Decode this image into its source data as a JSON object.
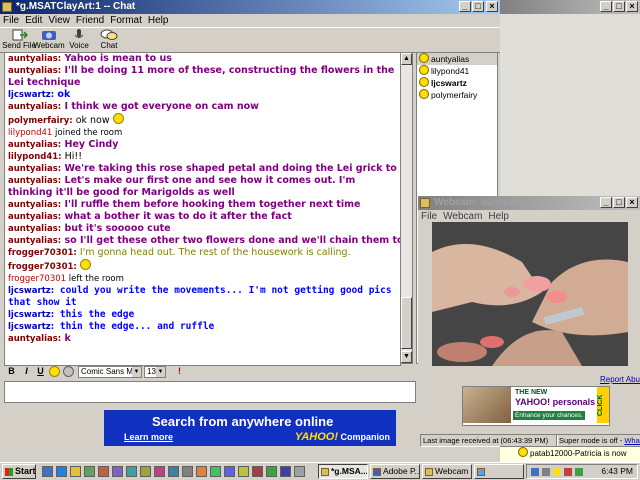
{
  "chat_window": {
    "title": "*g.MSATClayArt:1 -- Chat",
    "menu": [
      "File",
      "Edit",
      "View",
      "Friend",
      "Format",
      "Help"
    ],
    "toolbar": [
      {
        "label": "Send File",
        "icon": "send-file-icon"
      },
      {
        "label": "Webcam",
        "icon": "webcam-icon"
      },
      {
        "label": "Voice",
        "icon": "voice-icon"
      },
      {
        "label": "Chat",
        "icon": "chat-icon"
      }
    ]
  },
  "messages": [
    {
      "user": "auntyalias:",
      "text": " Yahoo is mean to us",
      "style": "aunty"
    },
    {
      "user": "auntyalias:",
      "text": " I'll be doing 11 more of these, constructing the flowers in the Lei technique",
      "style": "aunty",
      "wrap": true
    },
    {
      "user": "ljcswartz:",
      "text": " ok",
      "style": "lj"
    },
    {
      "user": "auntyalias:",
      "text": " I think we got everyone on cam now",
      "style": "aunty"
    },
    {
      "user": "polymerfairy:",
      "text": " ok now ",
      "style": "plain",
      "emoticon": true
    },
    {
      "system_user": "lilypond41",
      "system_text": " joined the room"
    },
    {
      "user": "auntyalias:",
      "text": " Hey Cindy",
      "style": "aunty"
    },
    {
      "user": "lilypond41:",
      "text": " Hi!!",
      "style": "plain"
    },
    {
      "user": "auntyalias:",
      "text": " We're taking this rose shaped petal and doing the Lei grick to it",
      "style": "aunty"
    },
    {
      "user": "auntyalias:",
      "text": " Let's make our first one and see how it comes out. I'm thinking it'll be good for Marigolds as well",
      "style": "aunty",
      "wrap": true
    },
    {
      "user": "auntyalias:",
      "text": " I'll ruffle them before hooking them together next time",
      "style": "aunty"
    },
    {
      "user": "auntyalias:",
      "text": " what a bother it was to do it after the fact",
      "style": "aunty"
    },
    {
      "user": "auntyalias:",
      "text": " but it's sooooo cute",
      "style": "aunty"
    },
    {
      "user": "auntyalias:",
      "text": " so I'll get these other two flowers done and we'll chain them together",
      "style": "aunty"
    },
    {
      "user": "frogger70301:",
      "text": " I'm gonna head out. The rest of the housework is calling.",
      "style": "frog"
    },
    {
      "user": "frogger70301:",
      "text": " ",
      "style": "plain",
      "emoticon": true
    },
    {
      "system_user": "frogger70301",
      "system_text": " left the room"
    },
    {
      "user": "ljcswartz:",
      "text": " could you write the movements... I'm not getting good pics that show it",
      "style": "lj-comic",
      "wrap": true
    },
    {
      "user": "ljcswartz:",
      "text": " this the edge",
      "style": "lj-comic"
    },
    {
      "user": "ljcswartz:",
      "text": " thin the edge... and ruffle",
      "style": "lj-comic-mixed"
    },
    {
      "user": "auntyalias:",
      "text": " k",
      "style": "aunty"
    }
  ],
  "users": [
    {
      "name": "auntyalias",
      "bold": false,
      "selected": true
    },
    {
      "name": "lilypond41",
      "bold": false,
      "selected": false
    },
    {
      "name": "ljcswartz",
      "bold": true,
      "selected": false
    },
    {
      "name": "polymerfairy",
      "bold": false,
      "selected": false
    }
  ],
  "format_bar": {
    "bold": "B",
    "italic": "I",
    "underline": "U",
    "font": "Comic Sans MS",
    "size": "13"
  },
  "ad_main": {
    "headline": "Search from anywhere online",
    "link": "Learn more",
    "brand": "YAHOO!",
    "brand_suffix": " Companion",
    "bg": "#1030c0"
  },
  "cam_window": {
    "title": "Webcam: auntyalias",
    "menu": [
      "File",
      "Webcam",
      "Help"
    ],
    "report": "Report Abu",
    "ad": {
      "the_new": "THE NEW",
      "yahoo": "YAHOO! personals",
      "tagline": "Enhance your chances.",
      "click": "CLICK"
    },
    "status_left": "Last image received at (06:43:39 PM)",
    "status_right_prefix": "Super mode is off - ",
    "status_right_link": "What's this"
  },
  "notification": "patab12000-Patricia is now online",
  "taskbar": {
    "start": "Start",
    "tasks": [
      {
        "label": "*g.MSA...",
        "active": true
      },
      {
        "label": "Adobe P...",
        "active": false
      },
      {
        "label": "Webcam ...",
        "active": false
      },
      {
        "label": "",
        "active": false
      }
    ],
    "clock": "6:43 PM"
  }
}
